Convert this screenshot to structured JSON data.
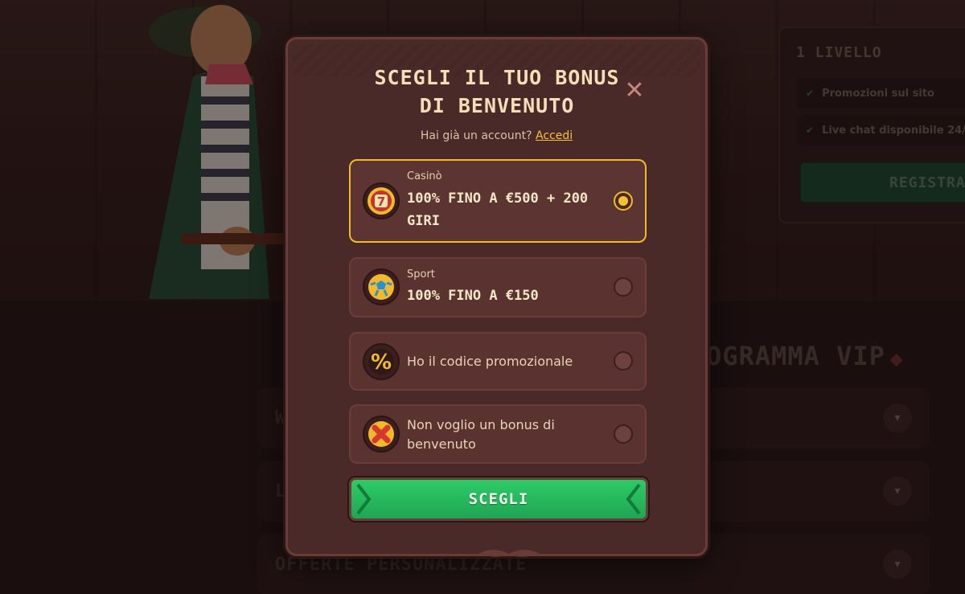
{
  "background": {
    "level_card": {
      "title": "1 LIVELLO",
      "items": [
        "Promozioni sul sito",
        "Live chat disponibile 24/"
      ],
      "register_label": "REGISTRAT"
    },
    "vip_title": "OGRAMMA VIP",
    "accordions": [
      {
        "label": "W"
      },
      {
        "label": "L"
      },
      {
        "label": "OFFERTE PERSONALIZZATE"
      }
    ]
  },
  "modal": {
    "title_line1": "SCEGLI IL TUO BONUS",
    "title_line2": "DI BENVENUTO",
    "close_symbol": "✕",
    "account_prompt": "Hai già un account?",
    "login_link": "Accedi",
    "options": [
      {
        "category": "Casinò",
        "label_line1": "100% FINO A €500 + 200",
        "label_line2": "GIRI",
        "icon": "slot-seven-icon",
        "selected": true
      },
      {
        "category": "Sport",
        "label": "100% FINO A €150",
        "icon": "soccer-ball-icon",
        "selected": false
      },
      {
        "label": "Ho il codice promozionale",
        "icon": "percent-icon",
        "selected": false
      },
      {
        "label_line1": "Non voglio un bonus di",
        "label_line2": "benvenuto",
        "icon": "red-cross-icon",
        "selected": false
      }
    ],
    "submit_label": "SCEGLI"
  },
  "colors": {
    "accent_gold": "#f2b92a",
    "button_green": "#2ecb67",
    "modal_bg": "#4a2a28"
  }
}
